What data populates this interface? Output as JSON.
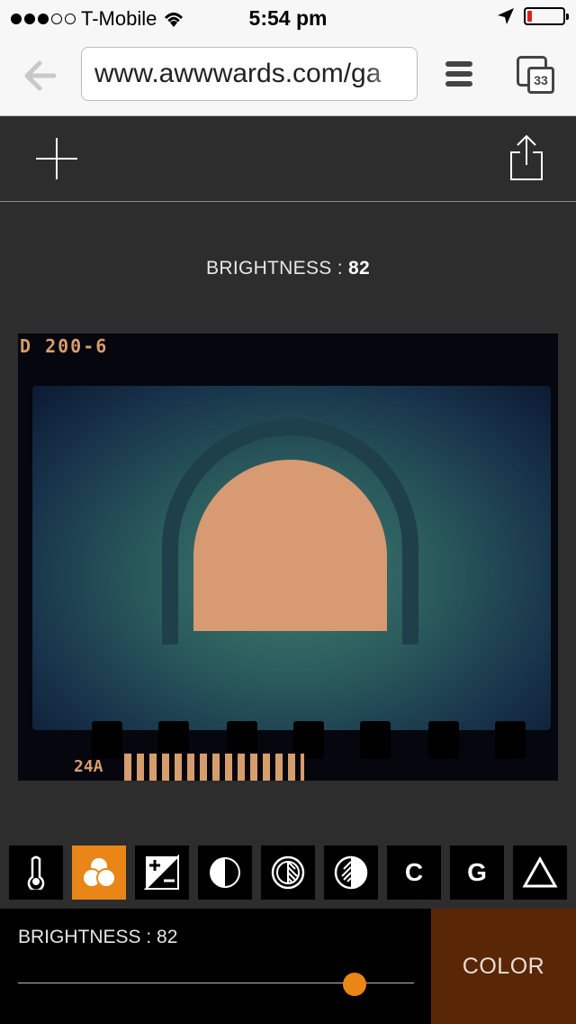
{
  "status_bar": {
    "carrier": "T-Mobile",
    "time": "5:54 pm",
    "signal_bars_filled": 3,
    "signal_bars_total": 5,
    "battery_level": 0.12
  },
  "browser": {
    "url": "www.awwwards.com/ga",
    "tab_count": "33"
  },
  "editor": {
    "heading_label": "BRIGHTNESS :",
    "heading_value": "82",
    "photo": {
      "frame_code_top": "D 200-6",
      "frame_code_bottom": "24A"
    },
    "tools": [
      {
        "name": "temperature-icon",
        "label": "",
        "active": false
      },
      {
        "name": "color-channels-icon",
        "label": "",
        "active": true
      },
      {
        "name": "exposure-icon",
        "label": "",
        "active": false
      },
      {
        "name": "contrast-icon",
        "label": "",
        "active": false
      },
      {
        "name": "highlights-icon",
        "label": "",
        "active": false
      },
      {
        "name": "shadows-icon",
        "label": "",
        "active": false
      },
      {
        "name": "c-icon",
        "label": "C",
        "active": false
      },
      {
        "name": "g-icon",
        "label": "G",
        "active": false
      },
      {
        "name": "triangle-icon",
        "label": "",
        "active": false
      }
    ],
    "control_label": "BRIGHTNESS : 82",
    "slider_fraction": 0.85,
    "color_button": "COLOR"
  },
  "colors": {
    "accent": "#e98617",
    "color_button_bg": "#5a2706",
    "panel_bg": "#2d2d2d"
  }
}
